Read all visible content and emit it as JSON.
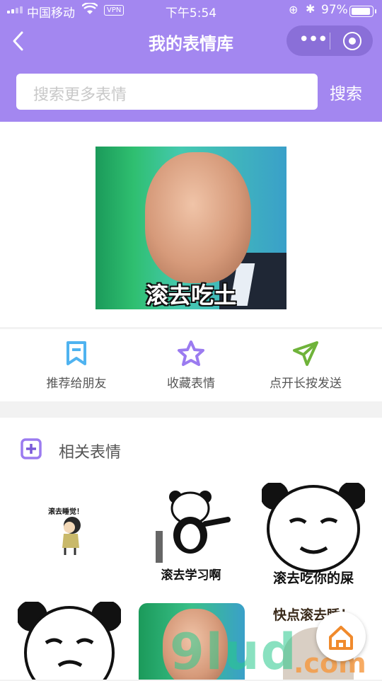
{
  "status_bar": {
    "carrier": "中国移动",
    "vpn": "VPN",
    "time": "下午5:54",
    "battery": "97%"
  },
  "nav": {
    "title": "我的表情库"
  },
  "search": {
    "placeholder": "搜索更多表情",
    "button_label": "搜索"
  },
  "main_sticker": {
    "caption": "滚去吃土"
  },
  "actions": [
    {
      "label": "推荐给朋友",
      "icon": "bookmark-icon",
      "color": "#4fb3f0"
    },
    {
      "label": "收藏表情",
      "icon": "star-icon",
      "color": "#9b7bf0"
    },
    {
      "label": "点开长按发送",
      "icon": "send-icon",
      "color": "#6fb33a"
    }
  ],
  "related": {
    "title": "相关表情",
    "items": [
      {
        "caption": "滚去睡觉！"
      },
      {
        "caption": "滚去学习啊"
      },
      {
        "caption": "滚去吃你的屎"
      },
      {
        "caption": ""
      },
      {
        "caption": ""
      },
      {
        "caption": "快点滚去睡！"
      }
    ]
  },
  "colors": {
    "brand": "#a387f0",
    "capsule": "#8a6fd8"
  }
}
